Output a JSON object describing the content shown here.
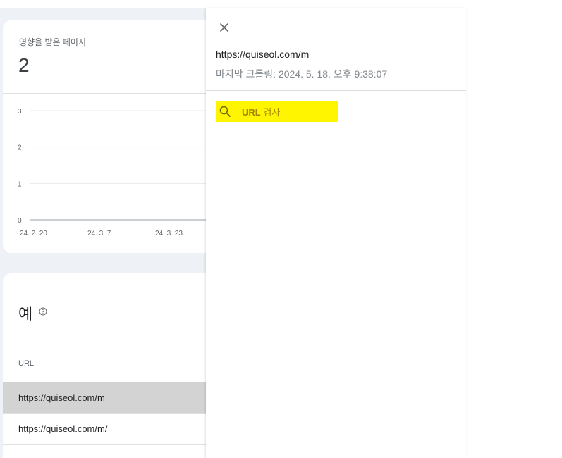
{
  "summary": {
    "metric_label": "영향을 받은 페이지",
    "metric_value": "2"
  },
  "chart_data": {
    "type": "line",
    "x": [
      "24. 2. 20.",
      "24. 3. 7.",
      "24. 3. 23."
    ],
    "series": [],
    "y_ticks": [
      "0",
      "1",
      "2",
      "3"
    ],
    "ylim": [
      0,
      3
    ],
    "grid": true
  },
  "examples": {
    "title": "예",
    "column_header": "URL",
    "rows": [
      "https://quiseol.com/m",
      "https://quiseol.com/m/"
    ]
  },
  "panel": {
    "url": "https://quiseol.com/m",
    "last_crawl": "마지막 크롤링: 2024. 5. 18. 오후 9:38:07",
    "inspect_button": {
      "label_bold": "URL",
      "label_rest": " 검사"
    }
  },
  "colors": {
    "highlight": "#fff500",
    "selected_row": "#d3d3d3",
    "page_bg": "#eef1f6"
  },
  "icons": [
    "close-icon",
    "search-icon",
    "help-icon"
  ]
}
